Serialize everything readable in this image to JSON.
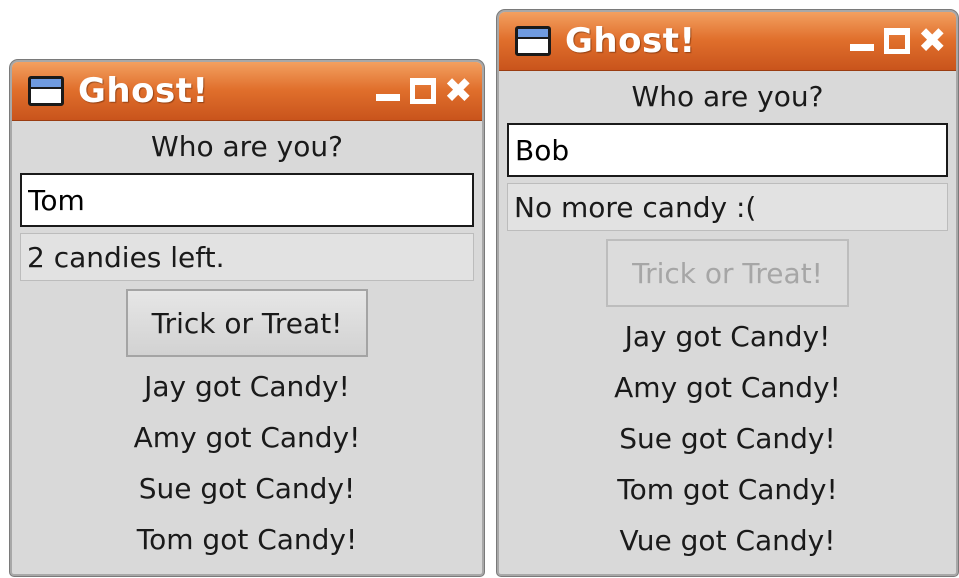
{
  "windows": [
    {
      "title": "Ghost!",
      "prompt": "Who are you?",
      "name_value": "Tom",
      "status": "2 candies left.",
      "button_label": "Trick or Treat!",
      "button_enabled": true,
      "log": [
        "Jay got Candy!",
        "Amy got Candy!",
        "Sue got Candy!",
        "Tom got Candy!"
      ]
    },
    {
      "title": "Ghost!",
      "prompt": "Who are you?",
      "name_value": "Bob",
      "status": "No more candy :(",
      "button_label": "Trick or Treat!",
      "button_enabled": false,
      "log": [
        "Jay got Candy!",
        "Amy got Candy!",
        "Sue got Candy!",
        "Tom got Candy!",
        "Vue got Candy!"
      ]
    }
  ],
  "icons": {
    "app": "app-window-icon",
    "minimize": "minimize-icon",
    "maximize": "maximize-icon",
    "close": "close-icon"
  },
  "theme": {
    "titlebar_accent": "#e06f2c",
    "window_bg": "#d9d9d9"
  }
}
